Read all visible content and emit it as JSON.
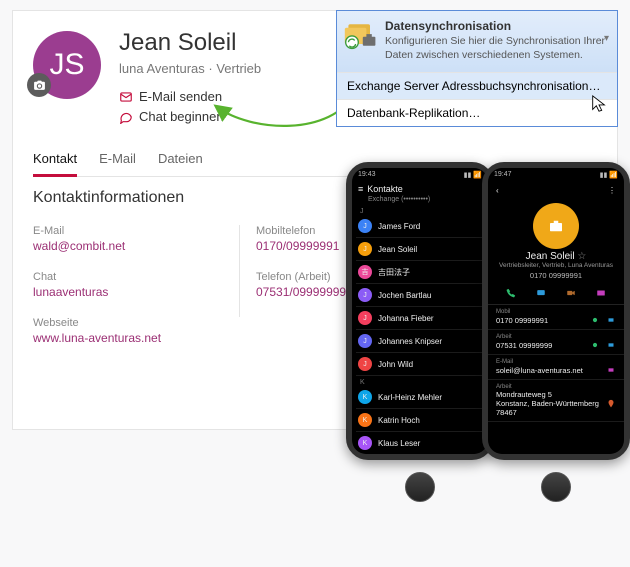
{
  "contact": {
    "initials": "JS",
    "name": "Jean Soleil",
    "subtitle": "luna Aventuras  ·  Vertrieb",
    "action_email": "E-Mail senden",
    "action_chat": "Chat beginnen"
  },
  "tabs": {
    "t1": "Kontakt",
    "t2": "E-Mail",
    "t3": "Dateien"
  },
  "section_title": "Kontaktinformationen",
  "fields": {
    "email_label": "E-Mail",
    "email_value": "wald@combit.net",
    "chat_label": "Chat",
    "chat_value": "lunaaventuras",
    "web_label": "Webseite",
    "web_value": "www.luna-aventuras.net",
    "mobile_label": "Mobiltelefon",
    "mobile_value": "0170/09999991",
    "workphone_label": "Telefon (Arbeit)",
    "workphone_value": "07531/09999999-0"
  },
  "sync": {
    "title": "Datensynchronisation",
    "desc": "Konfigurieren Sie hier die Synchronisation Ihrer Daten zwischen verschiedenen Systemen.",
    "item1": "Exchange Server Adressbuchsynchronisation…",
    "item2": "Datenbank-Replikation…"
  },
  "phone_list": {
    "time": "19:43",
    "header": "Kontakte",
    "source": "Exchange (••••••••••)",
    "letters": {
      "j": "J",
      "k": "K"
    },
    "contacts": [
      {
        "name": "James Ford",
        "color": "#3b82f6"
      },
      {
        "name": "Jean Soleil",
        "color": "#f59e0b"
      },
      {
        "name": "吉田法子",
        "color": "#ec4899"
      },
      {
        "name": "Jochen Bartlau",
        "color": "#8b5cf6"
      },
      {
        "name": "Johanna Fieber",
        "color": "#f43f5e"
      },
      {
        "name": "Johannes Knipser",
        "color": "#6366f1"
      },
      {
        "name": "John Wild",
        "color": "#ef4444"
      }
    ],
    "contacts_k": [
      {
        "name": "Karl-Heinz Mehler",
        "color": "#0ea5e9"
      },
      {
        "name": "Katrin Hoch",
        "color": "#f97316"
      },
      {
        "name": "Klaus Leser",
        "color": "#a855f7"
      }
    ]
  },
  "phone_detail": {
    "time": "19:47",
    "name": "Jean Soleil",
    "sub": "Vertriebsleiter, Vertrieb, Luna Aventuras",
    "main_phone": "0170 09999991",
    "mobile_label": "Mobil",
    "mobile_value": "0170 09999991",
    "work_label": "Arbeit",
    "work_value": "07531 09999999",
    "email_label": "E-Mail",
    "email_value": "soleil@luna-aventuras.net",
    "addr_label": "Arbeit",
    "addr_line1": "Mondrauteweg 5",
    "addr_line2": "Konstanz, Baden-Württemberg",
    "addr_line3": "78467"
  }
}
